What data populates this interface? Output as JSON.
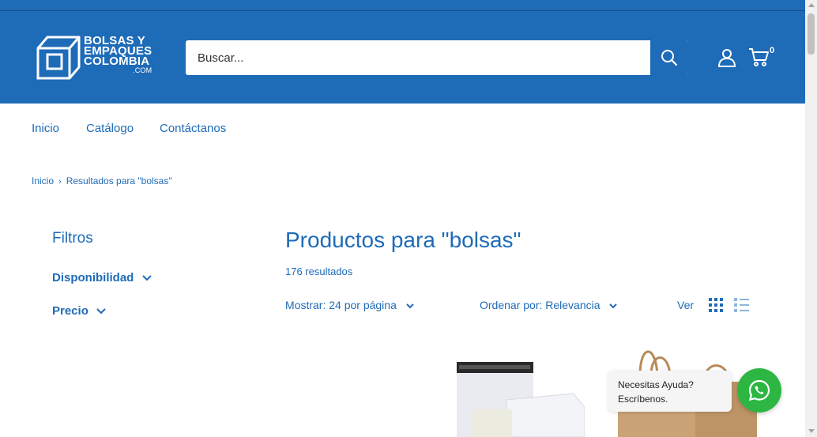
{
  "header": {
    "logo_lines": [
      "BOLSAS Y",
      "EMPAQUES",
      "COLOMBIA"
    ],
    "logo_domain": ".COM",
    "search_placeholder": "Buscar...",
    "cart_count": "0",
    "accent_color": "#1e6bb8"
  },
  "nav": {
    "items": [
      "Inicio",
      "Catálogo",
      "Contáctanos"
    ]
  },
  "breadcrumb": {
    "home": "Inicio",
    "current": "Resultados para \"bolsas\""
  },
  "filters": {
    "title": "Filtros",
    "groups": [
      "Disponibilidad",
      "Precio"
    ]
  },
  "results": {
    "title": "Productos para \"bolsas\"",
    "count": "176 resultados",
    "show_label": "Mostrar: 24 por página",
    "sort_label": "Ordenar por: Relevancia",
    "view_label": "Ver"
  },
  "whatsapp": {
    "line1": "Necesitas Ayuda?",
    "line2": "Escríbenos.",
    "color": "#2db742"
  }
}
